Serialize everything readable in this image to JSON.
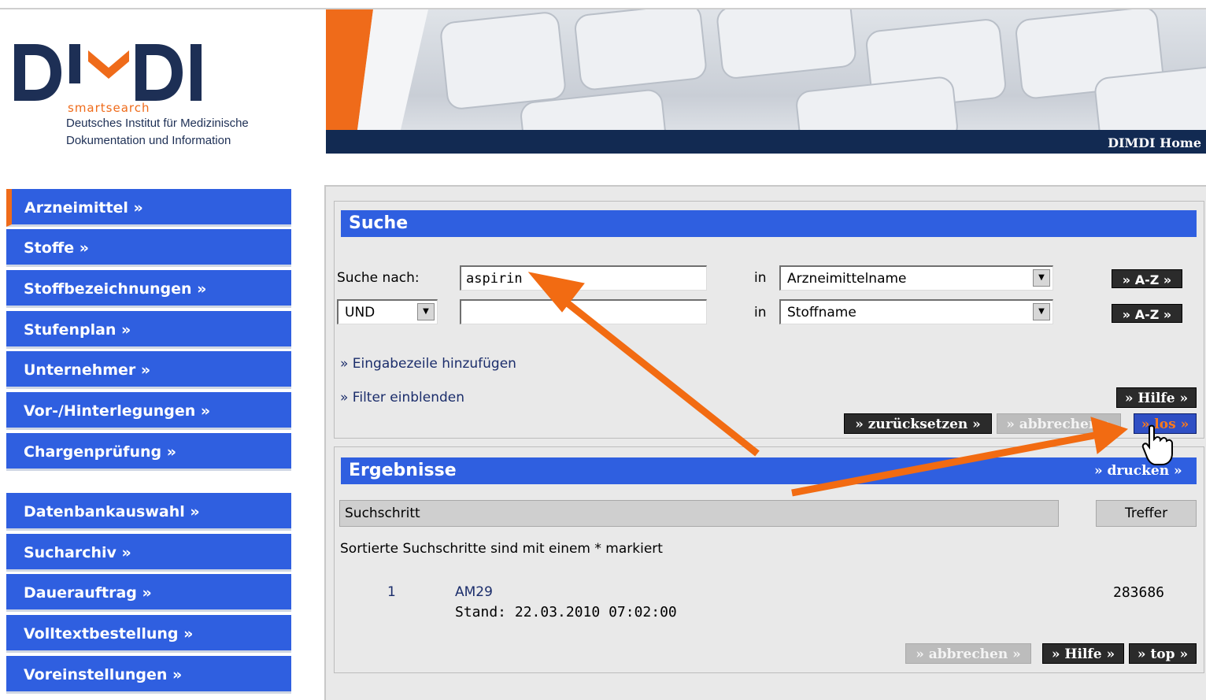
{
  "logo": {
    "sub": "smartsearch",
    "line1": "Deutsches Institut für Medizinische",
    "line2": "Dokumentation und Information"
  },
  "banner": {
    "home_link": "DIMDI Home"
  },
  "sidebar": {
    "items": [
      {
        "label": "Arzneimittel »"
      },
      {
        "label": "Stoffe »"
      },
      {
        "label": "Stoffbezeichnungen »"
      },
      {
        "label": "Stufenplan »"
      },
      {
        "label": "Unternehmer »"
      },
      {
        "label": "Vor-/Hinterlegungen »"
      },
      {
        "label": "Chargenprüfung »"
      },
      {
        "label": "Datenbankauswahl »"
      },
      {
        "label": "Sucharchiv »"
      },
      {
        "label": "Dauerauftrag »"
      },
      {
        "label": "Volltextbestellung »"
      },
      {
        "label": "Voreinstellungen »"
      }
    ]
  },
  "search": {
    "title": "Suche",
    "search_label": "Suche nach:",
    "term1": "aspirin",
    "in_label": "in",
    "field1": "Arzneimittelname",
    "operator": "UND",
    "term2": "",
    "field2": "Stoffname",
    "az_label": "» A-Z »",
    "add_row_link": "» Eingabezeile hinzufügen",
    "filter_link": "» Filter einblenden",
    "help_btn": "» Hilfe »",
    "reset_btn": "» zurücksetzen »",
    "cancel_btn": "» abbrechen »",
    "go_btn": "» los »"
  },
  "results": {
    "title": "Ergebnisse",
    "print_link": "» drucken »",
    "col_step": "Suchschritt",
    "col_hits": "Treffer",
    "note": "Sortierte Suchschritte sind mit einem * markiert",
    "rows": [
      {
        "num": "1",
        "db": "AM29",
        "stand": "Stand: 22.03.2010 07:02:00",
        "hits": "283686"
      }
    ],
    "cancel_btn": "» abbrechen »",
    "help_btn": "» Hilfe »",
    "top_btn": "» top »"
  },
  "colors": {
    "nav_blue": "#2f5fe0",
    "accent_orange": "#ef6b1a",
    "banner_navy": "#122a52"
  }
}
